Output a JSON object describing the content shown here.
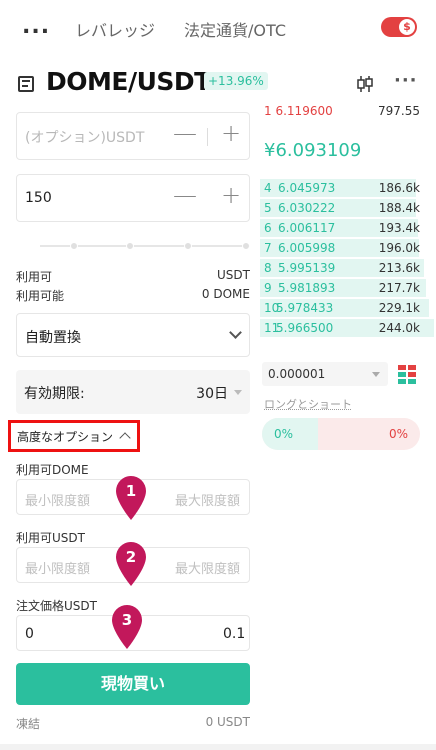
{
  "topnav": {
    "more": "...",
    "tabs": [
      "レバレッジ",
      "法定通貨/OTC"
    ],
    "toggle_symbol": "$"
  },
  "pair": {
    "name": "DOME/USDT",
    "change": "+13.96%"
  },
  "form": {
    "price_placeholder": "(オプション)USDT",
    "amount_value": "150",
    "minus": "—",
    "plus": "+",
    "available_label": "利用可",
    "available_value": "USDT",
    "possible_label": "利用可能",
    "possible_value": "0 DOME",
    "mode_select": "自動置換",
    "expiry_label": "有効期限:",
    "expiry_value": "30日",
    "advanced_label": "高度なオプション",
    "dome_label": "利用可DOME",
    "usdt_label": "利用可USDT",
    "order_price_label": "注文価格USDT",
    "min_placeholder": "最小限度額",
    "max_placeholder": "最大限度額",
    "order_price_min": "0",
    "order_price_max": "0.1",
    "buy_label": "現物買い",
    "frozen_label": "凍結",
    "frozen_value": "0 USDT"
  },
  "pins": [
    "1",
    "2",
    "3"
  ],
  "orderbook": {
    "top_ask": {
      "index": "1",
      "price": "6.119600",
      "amount": "797.55"
    },
    "last_price": "¥6.093109",
    "bids": [
      {
        "index": "4",
        "price": "6.045973",
        "amount": "186.6k",
        "fill": 0.35
      },
      {
        "index": "5",
        "price": "6.030222",
        "amount": "188.4k",
        "fill": 0.35
      },
      {
        "index": "6",
        "price": "6.006117",
        "amount": "193.4k",
        "fill": 0.36
      },
      {
        "index": "7",
        "price": "6.005998",
        "amount": "196.0k",
        "fill": 0.37
      },
      {
        "index": "8",
        "price": "5.995139",
        "amount": "213.6k",
        "fill": 0.4
      },
      {
        "index": "9",
        "price": "5.981893",
        "amount": "217.7k",
        "fill": 0.41
      },
      {
        "index": "10",
        "price": "5.978433",
        "amount": "229.1k",
        "fill": 0.43
      },
      {
        "index": "11",
        "price": "5.966500",
        "amount": "244.0k",
        "fill": 0.46
      }
    ],
    "tick_size": "0.000001",
    "long_short_label": "ロングとショート",
    "long_pct": "0%",
    "short_pct": "0%"
  },
  "colors": {
    "accent_green": "#2bbf9e",
    "accent_red": "#e34141",
    "highlight_box": "#ee1111",
    "pin": "#c2185b"
  },
  "icons": [
    "more-icon",
    "toggle-icon",
    "menu-icon",
    "candlestick-icon",
    "chevron-down-icon",
    "chevron-up-icon",
    "dropdown-triangle-icon",
    "depth-icon",
    "map-pin-icon"
  ]
}
